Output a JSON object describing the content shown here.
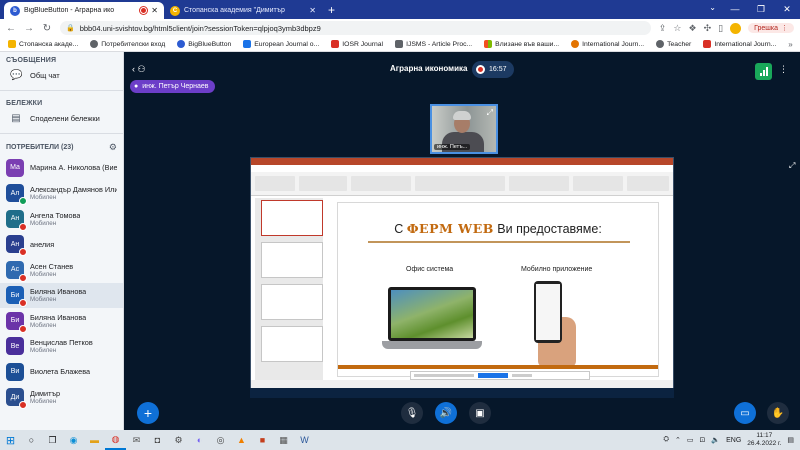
{
  "browser": {
    "tabs": [
      {
        "title": "BigBlueButton - Аграрна ико",
        "favicon": "bbb-icon",
        "recording": true
      },
      {
        "title": "Стопанска академия \"Димитър",
        "favicon": "sa-icon",
        "recording": false
      }
    ],
    "url": "bbb04.uni-svishtov.bg/html5client/join?sessionToken=qlpjoq3ymb3dbpz9",
    "error_label": "Грешка",
    "bookmarks": [
      {
        "label": "Стопанска акаде...",
        "color": "#f4b400"
      },
      {
        "label": "Потребителски вход",
        "color": "#5f6368"
      },
      {
        "label": "BigBlueButton",
        "color": "#2d5bd1"
      },
      {
        "label": "European Journal o...",
        "color": "#1a73e8"
      },
      {
        "label": "IOSR Journal",
        "color": "#d93025"
      },
      {
        "label": "IJSMS - Article Proc...",
        "color": "#5f6368"
      },
      {
        "label": "Влизане във ваши...",
        "color": "#7b1fa2"
      },
      {
        "label": "International Journ...",
        "color": "#e37400"
      },
      {
        "label": "Teacher",
        "color": "#5f6368"
      },
      {
        "label": "International Journ...",
        "color": "#d93025"
      }
    ]
  },
  "sidebar": {
    "messages_header": "СЪОБЩЕНИЯ",
    "public_chat": "Общ чат",
    "notes_header": "БЕЛЕЖКИ",
    "shared_notes": "Споделени бележки",
    "users_header": "ПОТРЕБИТЕЛИ (23)",
    "users": [
      {
        "initials": "Ма",
        "name": "Марина А. Николова (Вие)",
        "sub": "",
        "color": "#7b3fb2",
        "badge": "none",
        "selected": false
      },
      {
        "initials": "Ал",
        "name": "Александър Дамянов Илиев",
        "sub": "Мобилен",
        "color": "#1f4e9a",
        "badge": "green",
        "selected": false
      },
      {
        "initials": "Ан",
        "name": "Ангела Томова",
        "sub": "Мобилен",
        "color": "#1f6e8a",
        "badge": "red",
        "selected": false
      },
      {
        "initials": "Ан",
        "name": "анелия",
        "sub": "",
        "color": "#2a3f8f",
        "badge": "red",
        "selected": false
      },
      {
        "initials": "Ас",
        "name": "Асен Станев",
        "sub": "Мобилен",
        "color": "#2f6ab0",
        "badge": "red",
        "selected": false
      },
      {
        "initials": "Би",
        "name": "Биляна Иванова",
        "sub": "Мобилен",
        "color": "#1b5fb5",
        "badge": "red",
        "selected": true
      },
      {
        "initials": "Би",
        "name": "Биляна Иванова",
        "sub": "Мобилен",
        "color": "#6b33a8",
        "badge": "red",
        "selected": false
      },
      {
        "initials": "Ве",
        "name": "Венцислав Петков",
        "sub": "Мобилен",
        "color": "#4a2f9b",
        "badge": "none",
        "selected": false
      },
      {
        "initials": "Ви",
        "name": "Виолета Блажева",
        "sub": "",
        "color": "#1c4f96",
        "badge": "none",
        "selected": false
      },
      {
        "initials": "Ди",
        "name": "Димитър",
        "sub": "Мобилен",
        "color": "#2b4f8f",
        "badge": "red",
        "selected": false
      }
    ]
  },
  "meeting": {
    "title": "Аграрна икономика",
    "rec_time": "16:57",
    "presenter": "инж. Петър Чернаев",
    "webcam_label": "инж. Петъ..."
  },
  "slide": {
    "head_prefix": "С",
    "logo": "ФЕРМ WEB",
    "head_suffix": "Ви предоставяме:",
    "office_label": "Офис система",
    "mobile_label": "Мобилно приложение"
  },
  "taskbar": {
    "lang": "ENG",
    "time": "11:17",
    "date": "26.4.2022 г."
  }
}
